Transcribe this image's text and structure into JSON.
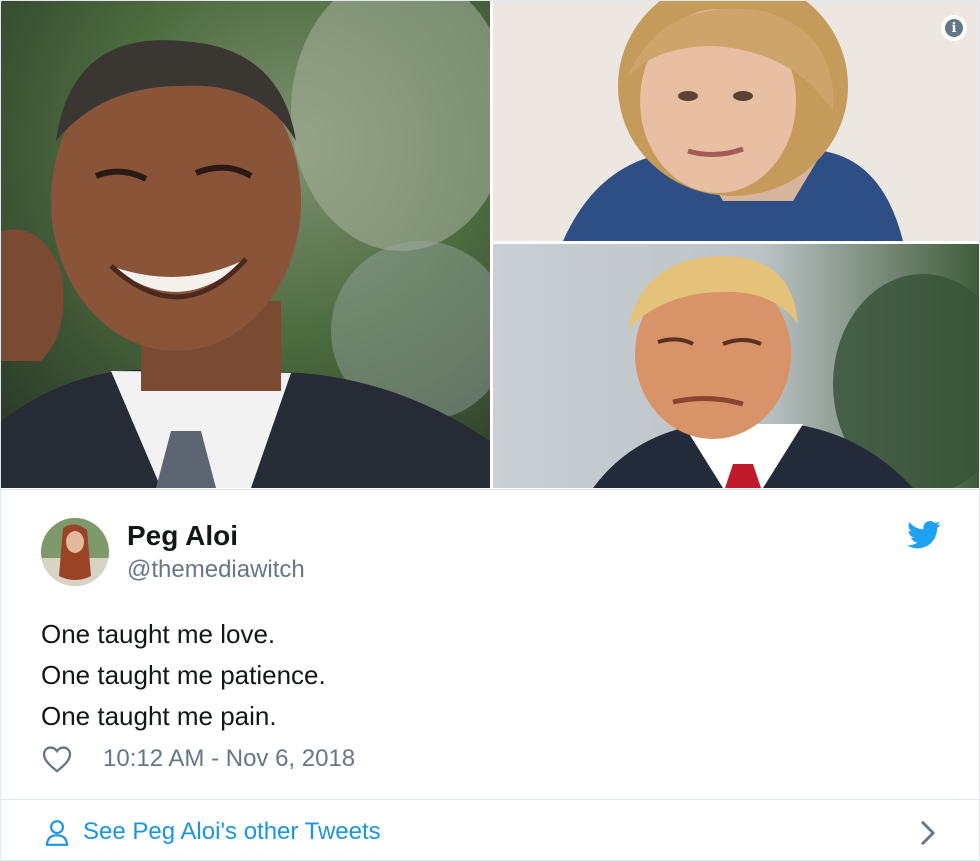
{
  "media": {
    "photos": [
      {
        "subject": "smiling man in dark suit"
      },
      {
        "subject": "woman with blonde hair in blue jacket"
      },
      {
        "subject": "man with blonde hair, red tie"
      }
    ],
    "info_icon": "info-icon"
  },
  "tweet": {
    "author": {
      "name": "Peg Aloi",
      "handle": "@themediawitch"
    },
    "lines": [
      "One taught me love.",
      "One taught me patience.",
      "One taught me pain."
    ],
    "timestamp": "10:12 AM - Nov 6, 2018",
    "icons": {
      "brand": "twitter-bird-icon",
      "like": "heart-icon"
    }
  },
  "footer": {
    "link_label": "See Peg Aloi's other Tweets",
    "icons": {
      "left": "person-icon",
      "right": "chevron-right-icon"
    }
  },
  "colors": {
    "link": "#1b95e0",
    "secondary_text": "#657786",
    "primary_text": "#14171a",
    "border": "#e1e8ed",
    "brand": "#1da1f2"
  }
}
